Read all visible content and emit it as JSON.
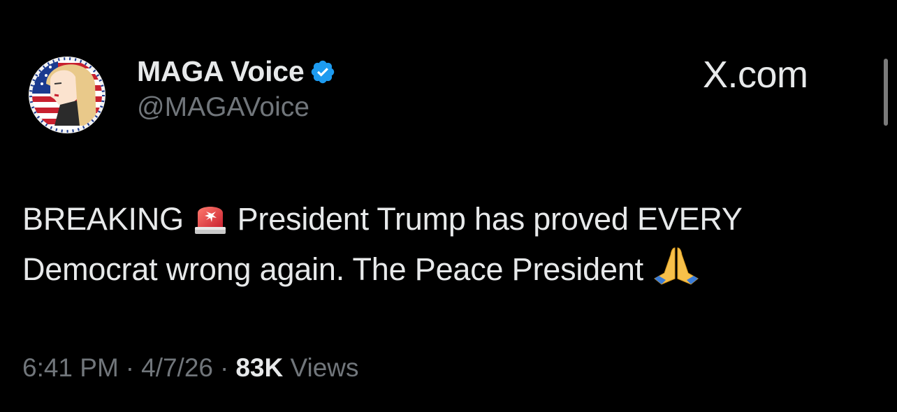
{
  "author": {
    "display_name": "MAGA Voice",
    "handle": "@MAGAVoice",
    "verified": true,
    "avatar_icon": "avatar-flag-portrait-icon"
  },
  "source_label": "X.com",
  "tweet": {
    "text_part1": "BREAKING",
    "emoji1": "police-siren-icon",
    "text_part2": "President Trump has proved EVERY Democrat wrong again. The Peace President",
    "emoji2": "folded-hands-icon"
  },
  "meta": {
    "time": "6:41 PM",
    "separator": "·",
    "date": "4/7/26",
    "views_count": "83K",
    "views_label": "Views"
  },
  "colors": {
    "background": "#000000",
    "text_primary": "#e7e9ea",
    "text_secondary": "#71767b",
    "verified_blue": "#1d9bf0"
  }
}
